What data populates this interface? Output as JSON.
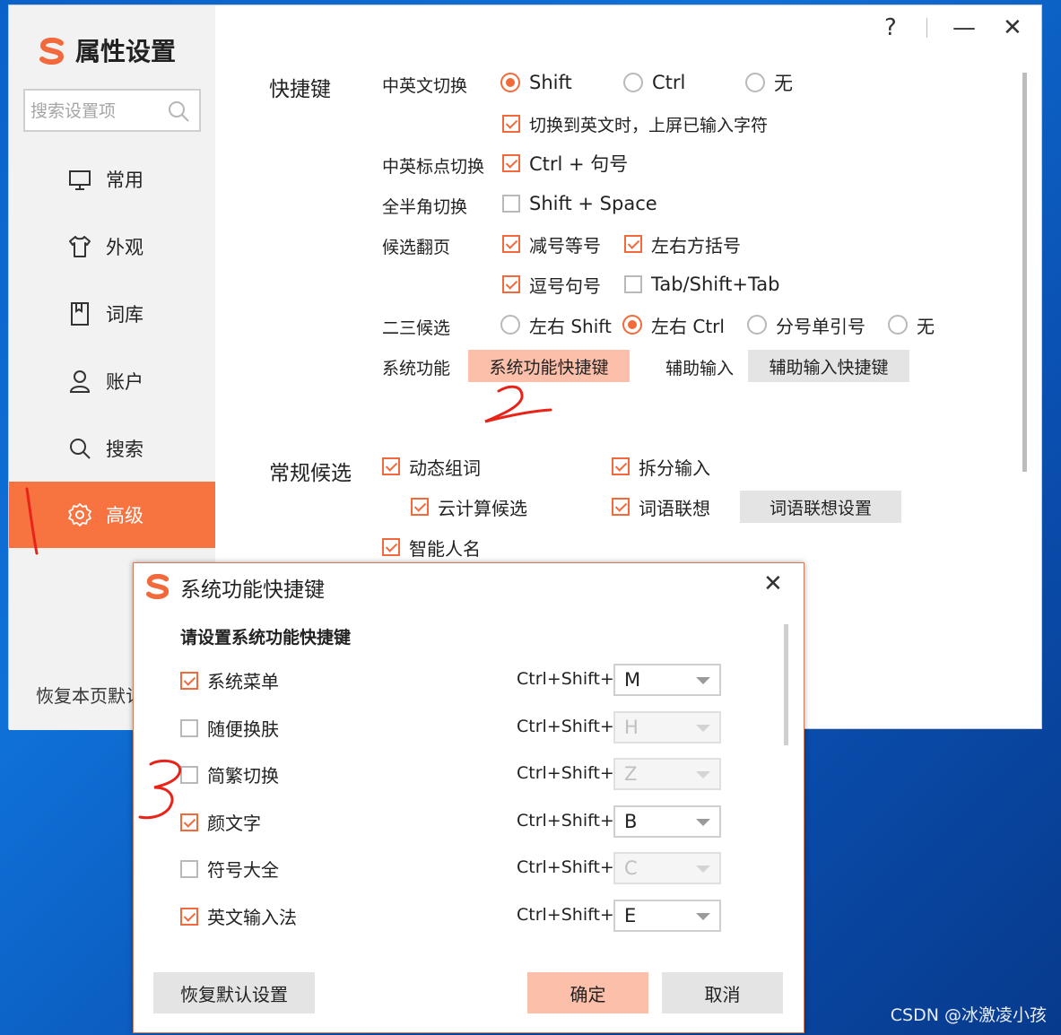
{
  "app": {
    "title": "属性设置",
    "search_placeholder": "搜索设置项"
  },
  "window_controls": {
    "help": "?",
    "minimize": "—",
    "close": "✕"
  },
  "sidebar": {
    "items": [
      {
        "label": "常用",
        "icon": "monitor-icon"
      },
      {
        "label": "外观",
        "icon": "shirt-icon"
      },
      {
        "label": "词库",
        "icon": "book-icon"
      },
      {
        "label": "账户",
        "icon": "user-icon"
      },
      {
        "label": "搜索",
        "icon": "search-icon"
      },
      {
        "label": "高级",
        "icon": "gear-icon",
        "active": true
      }
    ],
    "restore_page": "恢复本页默认"
  },
  "shortcuts": {
    "section_title": "快捷键",
    "cn_en_switch": {
      "label": "中英文切换",
      "options": [
        "Shift",
        "Ctrl",
        "无"
      ],
      "selected": "Shift",
      "sub_option": "切换到英文时，上屏已输入字符",
      "sub_checked": true
    },
    "punct_switch": {
      "label": "中英标点切换",
      "option": "Ctrl + 句号",
      "checked": true
    },
    "width_switch": {
      "label": "全半角切换",
      "option": "Shift + Space",
      "checked": false
    },
    "page_turn": {
      "label": "候选翻页",
      "options": [
        {
          "label": "减号等号",
          "checked": true
        },
        {
          "label": "左右方括号",
          "checked": true
        },
        {
          "label": "逗号句号",
          "checked": true
        },
        {
          "label": "Tab/Shift+Tab",
          "checked": false
        }
      ]
    },
    "second_third": {
      "label": "二三候选",
      "options": [
        "左右 Shift",
        "左右 Ctrl",
        "分号单引号",
        "无"
      ],
      "selected": "左右 Ctrl"
    },
    "system_func": {
      "label": "系统功能",
      "button": "系统功能快捷键",
      "assist_label": "辅助输入",
      "assist_button": "辅助输入快捷键"
    }
  },
  "general_candidates": {
    "section_title": "常规候选",
    "options": [
      {
        "label": "动态组词",
        "checked": true
      },
      {
        "label": "拆分输入",
        "checked": true
      },
      {
        "label": "云计算候选",
        "checked": true
      },
      {
        "label": "词语联想",
        "checked": true
      },
      {
        "label": "智能人名",
        "checked": true
      }
    ],
    "assoc_button": "词语联想设置"
  },
  "dialog": {
    "title": "系统功能快捷键",
    "heading": "请设置系统功能快捷键",
    "close": "✕",
    "rows": [
      {
        "name": "系统菜单",
        "checked": true,
        "prefix": "Ctrl+Shift+",
        "key": "M"
      },
      {
        "name": "随便换肤",
        "checked": false,
        "prefix": "Ctrl+Shift+",
        "key": "H"
      },
      {
        "name": "简繁切换",
        "checked": false,
        "prefix": "Ctrl+Shift+",
        "key": "Z"
      },
      {
        "name": "颜文字",
        "checked": true,
        "prefix": "Ctrl+Shift+",
        "key": "B"
      },
      {
        "name": "符号大全",
        "checked": false,
        "prefix": "Ctrl+Shift+",
        "key": "C"
      },
      {
        "name": "英文输入法",
        "checked": true,
        "prefix": "Ctrl+Shift+",
        "key": "E"
      }
    ],
    "buttons": {
      "restore": "恢复默认设置",
      "ok": "确定",
      "cancel": "取消"
    }
  },
  "watermark": "CSDN @冰激凌小孩",
  "colors": {
    "accent": "#f7733f",
    "peach": "#fbbfaa",
    "annotation": "#e8231a"
  }
}
